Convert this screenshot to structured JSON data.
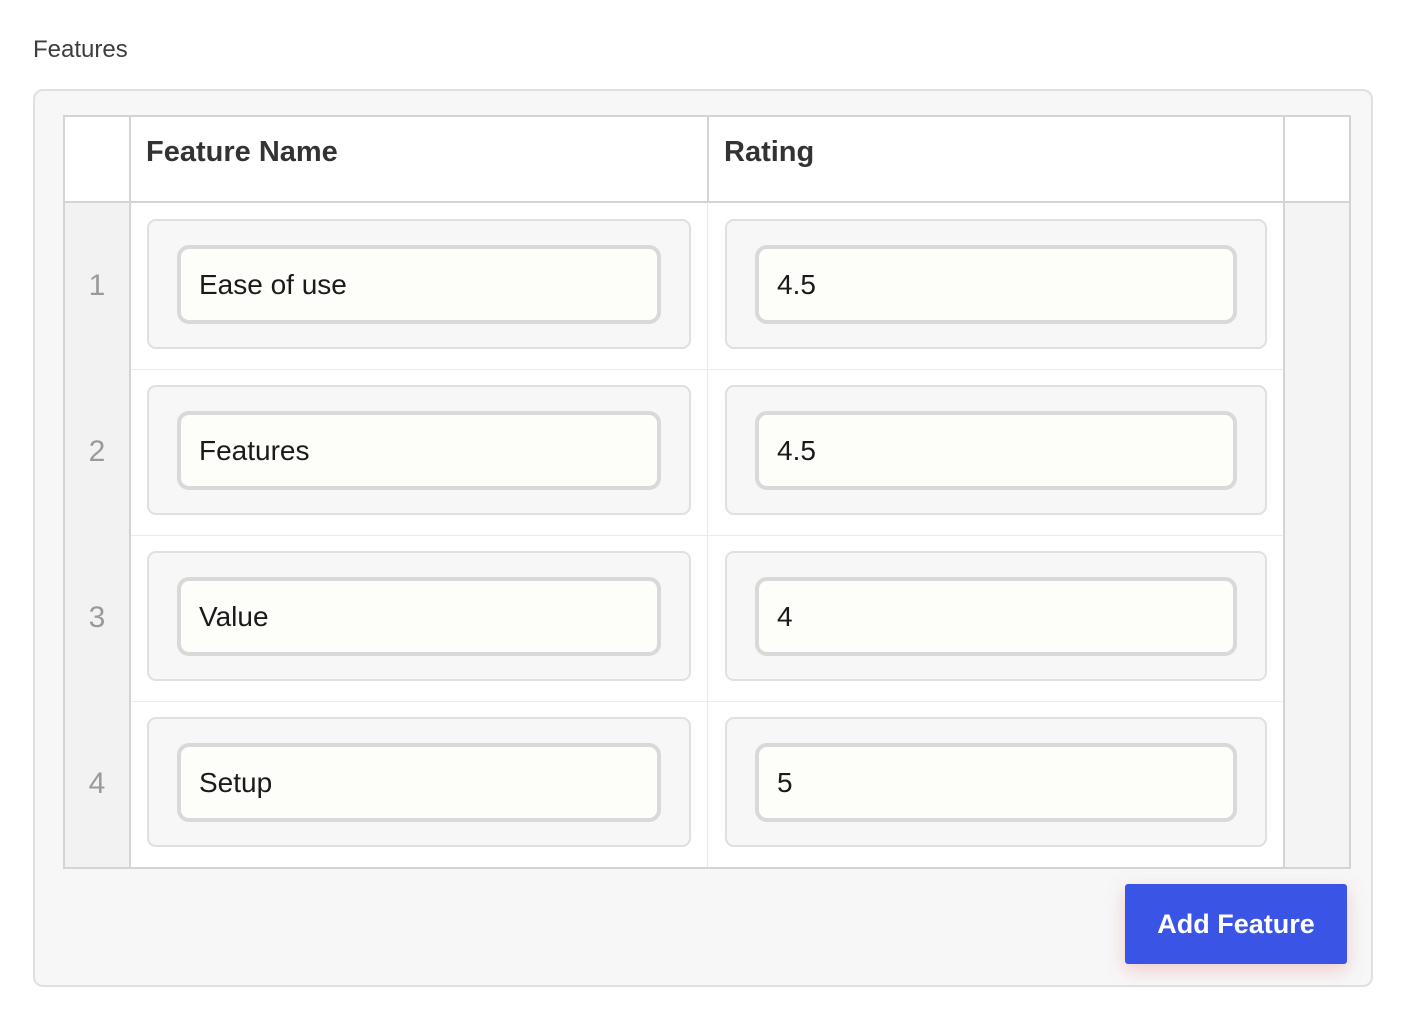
{
  "section": {
    "label": "Features"
  },
  "table": {
    "columns": [
      {
        "label": ""
      },
      {
        "label": "Feature Name"
      },
      {
        "label": "Rating"
      },
      {
        "label": ""
      }
    ],
    "rows": [
      {
        "index": "1",
        "feature_name": "Ease of use",
        "rating": "4.5"
      },
      {
        "index": "2",
        "feature_name": "Features",
        "rating": "4.5"
      },
      {
        "index": "3",
        "feature_name": "Value",
        "rating": "4"
      },
      {
        "index": "4",
        "feature_name": "Setup",
        "rating": "5"
      }
    ]
  },
  "actions": {
    "add_label": "Add Feature"
  },
  "colors": {
    "accent": "#3a55e6",
    "panel_bg": "#f7f7f7",
    "border": "#d4d4d4"
  }
}
